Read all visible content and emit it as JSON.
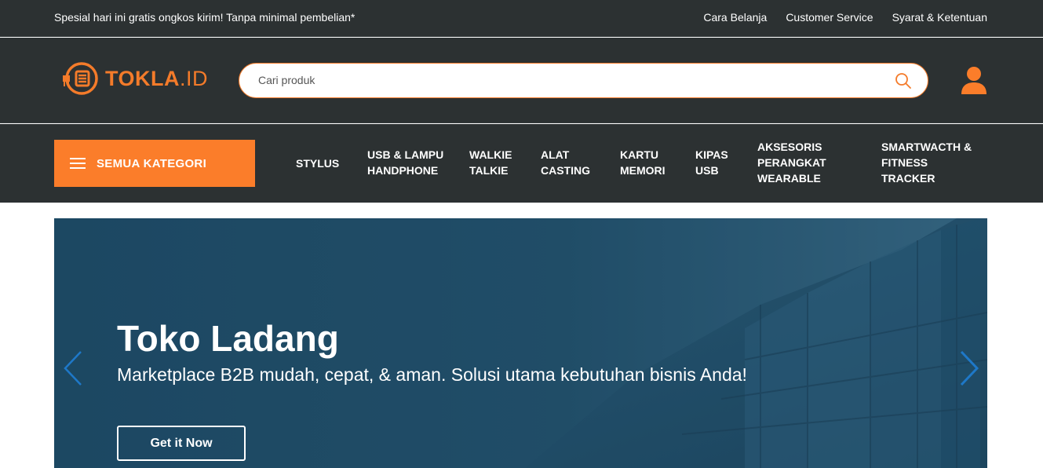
{
  "topbar": {
    "promo": "Spesial hari ini gratis ongkos kirim! Tanpa minimal pembelian*",
    "links": [
      "Cara Belanja",
      "Customer Service",
      "Syarat & Ketentuan"
    ]
  },
  "header": {
    "logo_main": "TOKLA",
    "logo_suffix": ".ID",
    "search_placeholder": "Cari produk",
    "search_icon": "search-icon",
    "account_icon": "user-icon",
    "accent_color": "#f47b2a"
  },
  "nav": {
    "all_categories": "SEMUA KATEGORI",
    "items": [
      [
        "STYLUS"
      ],
      [
        "USB & LAMPU",
        "HANDPHONE"
      ],
      [
        "WALKIE",
        "TALKIE"
      ],
      [
        "ALAT",
        "CASTING"
      ],
      [
        "KARTU",
        "MEMORI"
      ],
      [
        "KIPAS",
        "USB"
      ],
      [
        "AKSESORIS",
        "PERANGKAT",
        "WEARABLE"
      ],
      [
        "SMARTWACTH &",
        "FITNESS",
        "TRACKER"
      ]
    ]
  },
  "hero": {
    "title": "Toko Ladang",
    "subtitle": "Marketplace B2B mudah, cepat, & aman. Solusi utama kebutuhan bisnis Anda!",
    "button": "Get it Now",
    "prev_icon": "chevron-left-icon",
    "next_icon": "chevron-right-icon"
  }
}
